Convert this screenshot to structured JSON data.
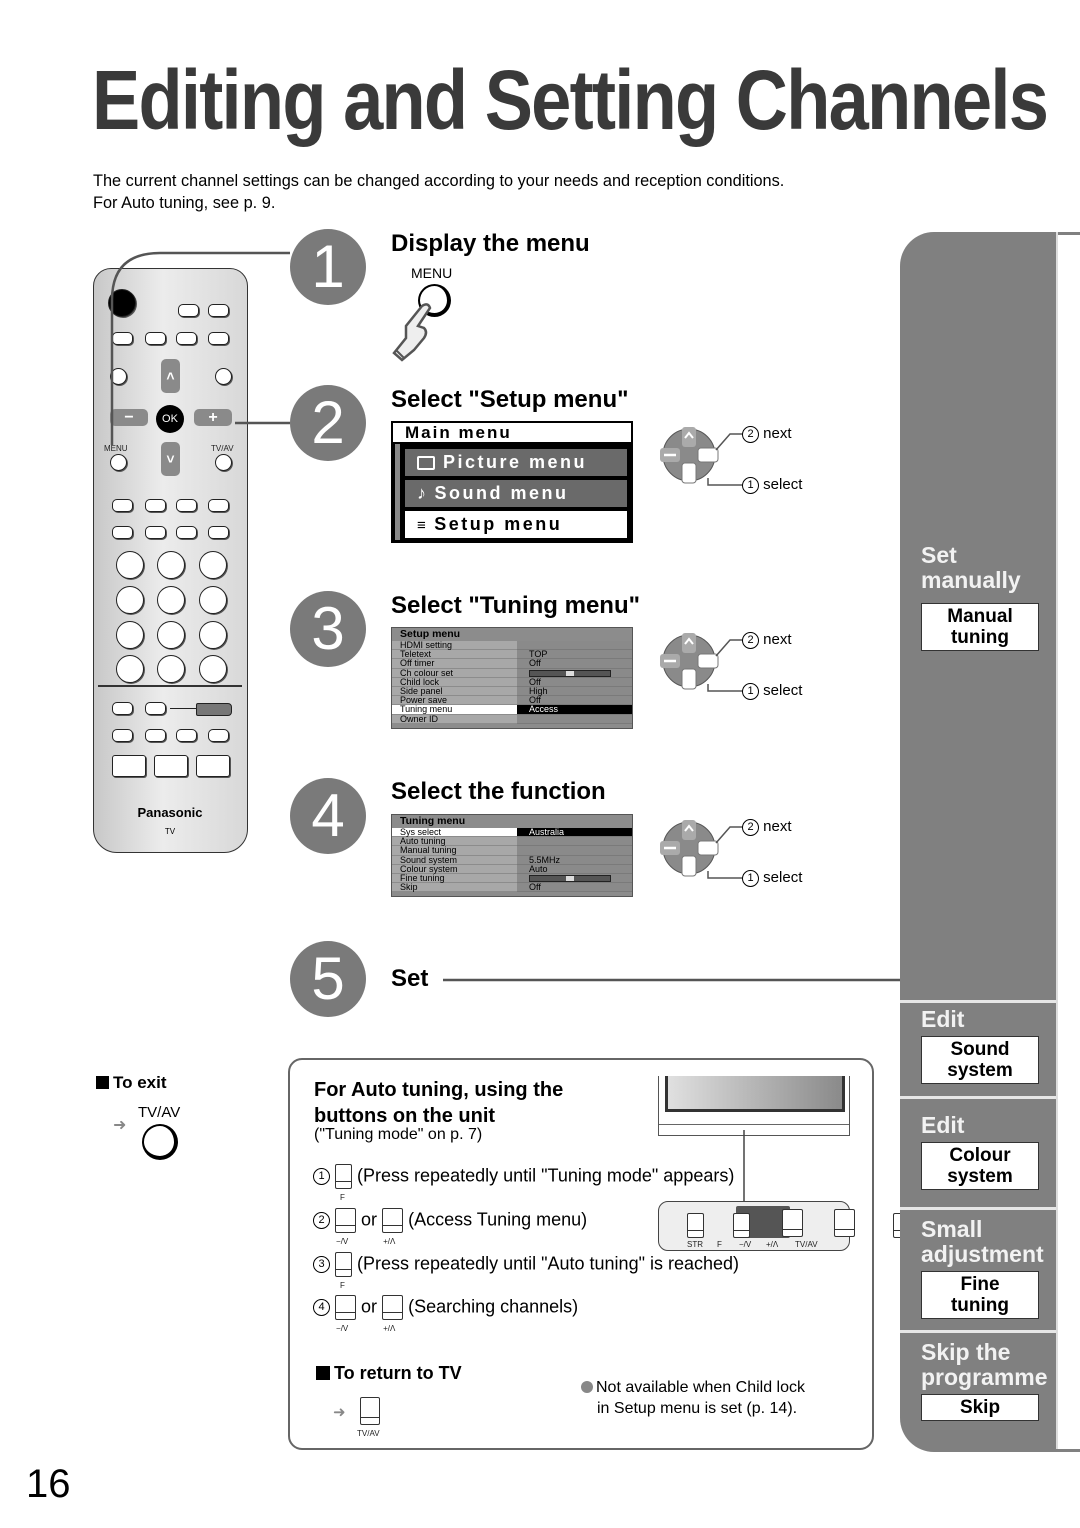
{
  "page": {
    "title": "Editing and Setting Channels",
    "intro_line1": "The current channel settings can be changed according to your needs and reception conditions.",
    "intro_line2": "For Auto tuning, see p. 9.",
    "page_number": "16"
  },
  "remote": {
    "brand": "Panasonic",
    "model": "TV",
    "menu_label": "MENU",
    "tvav_label": "TV/AV",
    "ok_label": "OK",
    "minus_label": "−",
    "plus_label": "+",
    "up_label": "˄",
    "down_label": "˅"
  },
  "steps": [
    {
      "num": "1",
      "heading": "Display the menu",
      "button_label": "MENU"
    },
    {
      "num": "2",
      "heading": "Select \"Setup menu\""
    },
    {
      "num": "3",
      "heading": "Select \"Tuning menu\""
    },
    {
      "num": "4",
      "heading": "Select the function"
    },
    {
      "num": "5",
      "heading": "Set"
    }
  ],
  "main_menu": {
    "title": "Main menu",
    "items": [
      {
        "icon": "picture-icon",
        "label": "Picture menu"
      },
      {
        "icon": "music-note-icon",
        "label": "Sound menu"
      },
      {
        "icon": "list-icon",
        "label": "Setup menu",
        "selected": true
      }
    ]
  },
  "setup_menu": {
    "title": "Setup menu",
    "rows": [
      {
        "label": "HDMI setting",
        "value": ""
      },
      {
        "label": "Teletext",
        "value": "TOP"
      },
      {
        "label": "Off timer",
        "value": "Off"
      },
      {
        "label": "Ch colour set",
        "value": "",
        "slider": 0.5
      },
      {
        "label": "Child lock",
        "value": "Off"
      },
      {
        "label": "Side panel",
        "value": "High"
      },
      {
        "label": "Power save",
        "value": "Off"
      },
      {
        "label": "Tuning menu",
        "value": "Access",
        "selected": true
      },
      {
        "label": "Owner ID",
        "value": ""
      }
    ]
  },
  "tuning_menu": {
    "title": "Tuning menu",
    "rows": [
      {
        "label": "Sys select",
        "value": "Australia",
        "selected": true
      },
      {
        "label": "Auto tuning",
        "value": ""
      },
      {
        "label": "Manual tuning",
        "value": ""
      },
      {
        "label": "Sound system",
        "value": "5.5MHz"
      },
      {
        "label": "Colour system",
        "value": "Auto"
      },
      {
        "label": "Fine tuning",
        "value": "",
        "slider": 0.5
      },
      {
        "label": "Skip",
        "value": "Off"
      }
    ]
  },
  "cursor_pad": {
    "next_num": "2",
    "next_label": "next",
    "select_num": "1",
    "select_label": "select"
  },
  "to_exit": {
    "heading": "To exit",
    "button_label": "TV/AV"
  },
  "auto_tuning": {
    "heading_line1": "For Auto tuning, using the",
    "heading_line2": "buttons on the unit",
    "reference": "(\"Tuning mode\" on p. 7)",
    "instructions": [
      {
        "num": "1",
        "buttons": [
          "F"
        ],
        "text": "(Press repeatedly until \"Tuning mode\" appears)"
      },
      {
        "num": "2",
        "buttons": [
          "−/V",
          "+/Λ"
        ],
        "joiner": "or",
        "text": "(Access Tuning menu)"
      },
      {
        "num": "3",
        "buttons": [
          "F"
        ],
        "text": "(Press repeatedly until \"Auto tuning\" is reached)"
      },
      {
        "num": "4",
        "buttons": [
          "−/V",
          "+/Λ"
        ],
        "joiner": "or",
        "text": "(Searching channels)"
      }
    ],
    "unit_buttons": [
      "STR",
      "F",
      "−/V",
      "+/Λ",
      "TV/AV"
    ],
    "return_heading": "To return to TV",
    "return_button": "TV/AV",
    "note_line1": "Not available when Child lock",
    "note_line2": "in Setup menu is set (p. 14)."
  },
  "sidebar": {
    "sections": [
      {
        "title_line1": "Set",
        "title_line2": "manually",
        "box_line1": "Manual",
        "box_line2": "tuning"
      },
      {
        "title_line1": "Edit",
        "title_line2": "",
        "box_line1": "Sound",
        "box_line2": "system"
      },
      {
        "title_line1": "Edit",
        "title_line2": "",
        "box_line1": "Colour",
        "box_line2": "system"
      },
      {
        "title_line1": "Small",
        "title_line2": "adjustment",
        "box_line1": "Fine",
        "box_line2": "tuning"
      },
      {
        "title_line1": "Skip the",
        "title_line2": "programme",
        "box_line1": "Skip",
        "box_line2": ""
      }
    ]
  },
  "colors": {
    "sidebar": "#808080",
    "step_circle": "#7a7a7a",
    "title": "#3a3a3a"
  }
}
